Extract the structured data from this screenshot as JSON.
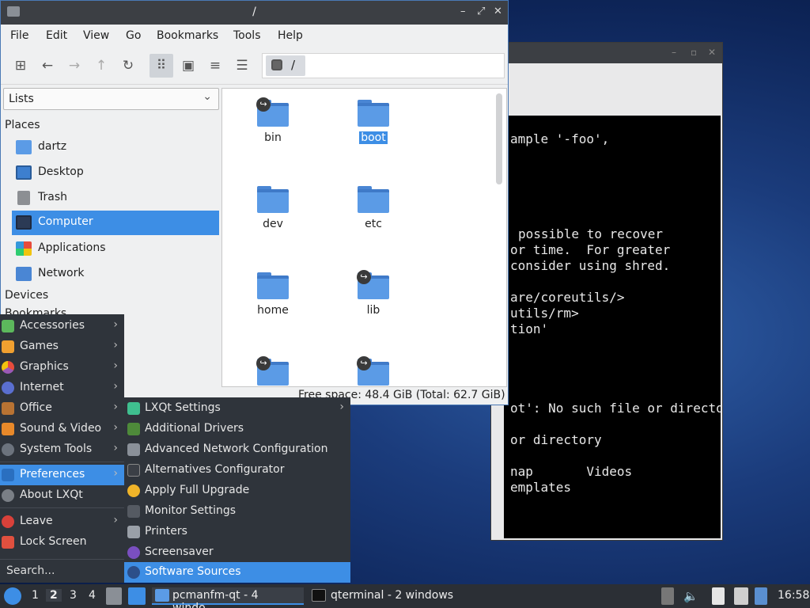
{
  "terminal": {
    "lines": [
      "ample '-foo',",
      "possible to recover",
      "or time.  For greater",
      "consider using shred.",
      "are/coreutils/>",
      "utils/rm>",
      "tion'",
      "ot': No such file or directory",
      "or directory",
      "nap       Videos",
      "emplates"
    ]
  },
  "file_manager": {
    "title": "/",
    "menu": [
      "File",
      "Edit",
      "View",
      "Go",
      "Bookmarks",
      "Tools",
      "Help"
    ],
    "address": "/",
    "side_dropdown": "Lists",
    "places_header": "Places",
    "places": [
      "dartz",
      "Desktop",
      "Trash",
      "Computer",
      "Applications",
      "Network"
    ],
    "devices_header": "Devices",
    "bookmarks_header": "Bookmarks",
    "files": [
      "bin",
      "boot",
      "dev",
      "etc",
      "home",
      "lib",
      "",
      ""
    ],
    "status": "Free space: 48.4 GiB (Total: 62.7 GiB)"
  },
  "start_menu": {
    "categories": [
      "Accessories",
      "Games",
      "Graphics",
      "Internet",
      "Office",
      "Sound & Video",
      "System Tools",
      "Preferences",
      "About LXQt",
      "Leave",
      "Lock Screen"
    ],
    "search_placeholder": "Search...",
    "preferences_items": [
      "LXQt Settings",
      "Additional Drivers",
      "Advanced Network Configuration",
      "Alternatives Configurator",
      "Apply Full Upgrade",
      "Monitor Settings",
      "Printers",
      "Screensaver",
      "Software Sources"
    ]
  },
  "panel": {
    "desktops": [
      "1",
      "2",
      "3",
      "4"
    ],
    "tasks": [
      "pcmanfm-qt - 4 windo...",
      "qterminal - 2 windows"
    ],
    "clock": "16:58"
  },
  "colors": {
    "accent": "#3d8ee5",
    "folder": "#5b9be6",
    "panel": "#2b2f35",
    "menu": "#2f343b"
  }
}
